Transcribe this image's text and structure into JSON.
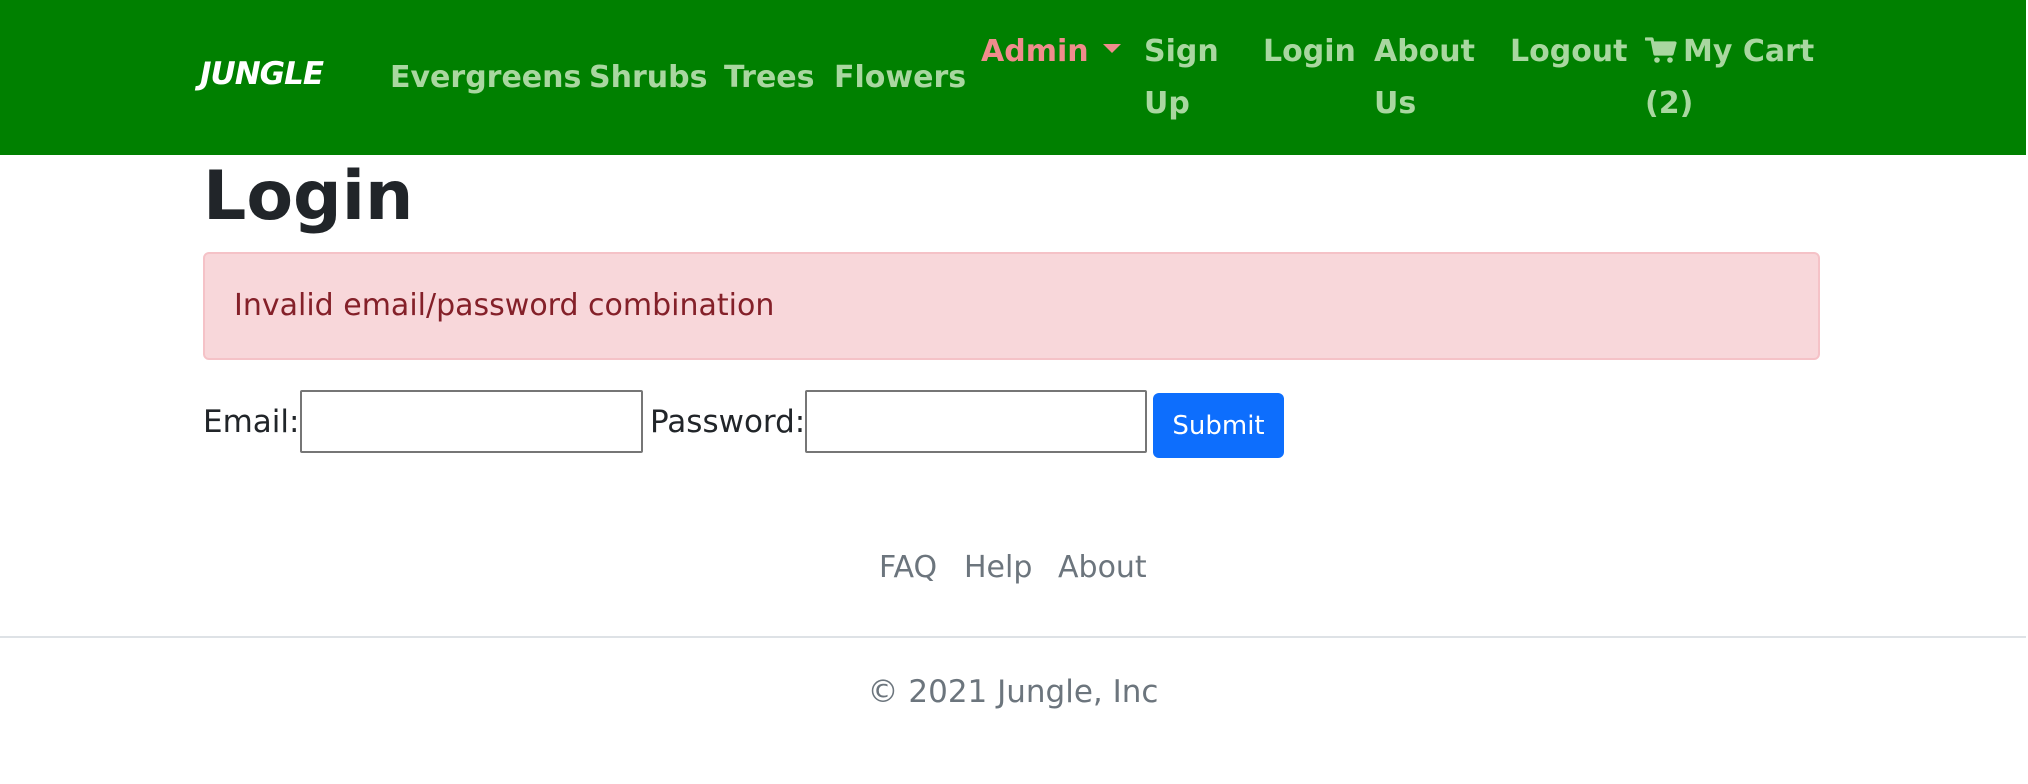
{
  "navbar": {
    "brand": "JUNGLE",
    "links": {
      "evergreens": "Evergreens",
      "shrubs": "Shrubs",
      "trees": "Trees",
      "flowers": "Flowers"
    },
    "admin": "Admin",
    "signup_line1": "Sign",
    "signup_line2": "Up",
    "login": "Login",
    "about_line1": "About",
    "about_line2": "Us",
    "logout": "Logout",
    "cart_line1": "My Cart",
    "cart_line2": "(2)",
    "cart_icon": "shopping-cart-icon"
  },
  "page": {
    "title": "Login",
    "alert": "Invalid email/password combination"
  },
  "form": {
    "email_label": "Email:",
    "email_value": "",
    "password_label": "Password:",
    "password_value": "",
    "submit_label": "Submit"
  },
  "footer": {
    "links": {
      "faq": "FAQ",
      "help": "Help",
      "about": "About"
    },
    "copyright": "© 2021 Jungle, Inc"
  },
  "colors": {
    "navbar_bg": "#008000",
    "nav_link": "#a9d7a0",
    "admin_link": "#f08c8c",
    "alert_bg": "#f8d7da",
    "alert_text": "#842029",
    "submit_bg": "#0d6efd",
    "footer_text": "#6c757d"
  }
}
